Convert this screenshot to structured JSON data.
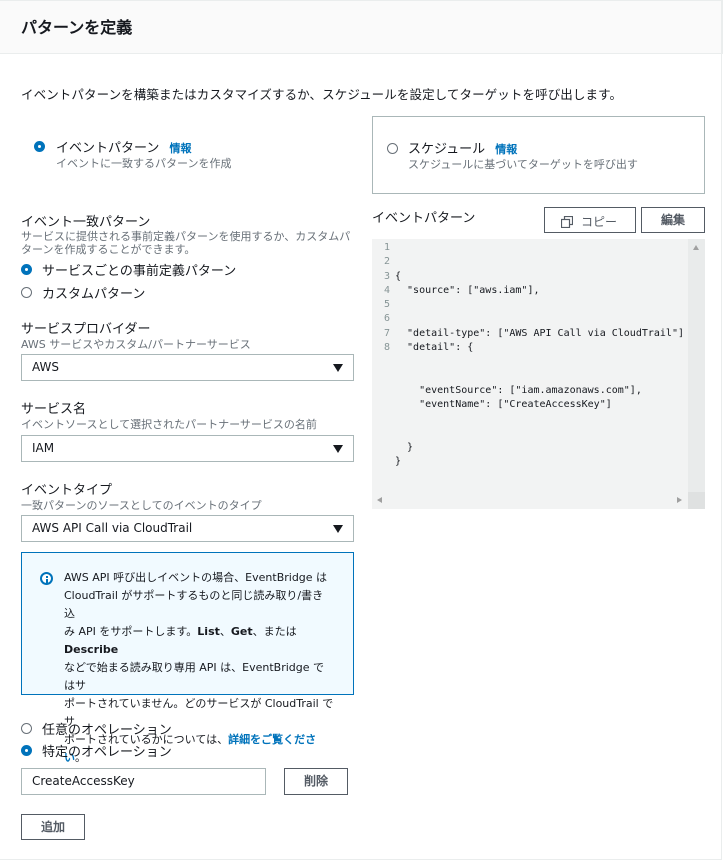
{
  "panel": {
    "title": "パターンを定義"
  },
  "description": "イベントパターンを構築またはカスタマイズするか、スケジュールを設定してターゲットを呼び出します。",
  "pattern_type": {
    "event_pattern": {
      "label": "イベントパターン",
      "info": "情報",
      "sub": "イベントに一致するパターンを作成",
      "selected": true
    },
    "schedule": {
      "label": "スケジュール",
      "info": "情報",
      "sub": "スケジュールに基づいてターゲットを呼び出す",
      "selected": false
    }
  },
  "match": {
    "title": "イベント一致パターン",
    "desc_line1": "サービスに提供される事前定義パターンを使用するか、カスタムパ",
    "desc_line2": "ターンを作成することができます。",
    "options": [
      {
        "label": "サービスごとの事前定義パターン",
        "selected": true
      },
      {
        "label": "カスタムパターン",
        "selected": false
      }
    ]
  },
  "provider": {
    "label": "サービスプロバイダー",
    "sub": "AWS サービスやカスタム/パートナーサービス",
    "value": "AWS"
  },
  "service": {
    "label": "サービス名",
    "sub": "イベントソースとして選択されたパートナーサービスの名前",
    "value": "IAM"
  },
  "event_type": {
    "label": "イベントタイプ",
    "sub": "一致パターンのソースとしてのイベントのタイプ",
    "value": "AWS API Call via CloudTrail"
  },
  "info": {
    "p1": "AWS API 呼び出しイベントの場合、EventBridge は",
    "p2": "CloudTrail がサポートするものと同じ読み取り/書き込",
    "p3": "み API をサポートします。",
    "b1": "List",
    "sep1": "、",
    "b2": "Get",
    "sep2": "、または ",
    "b3": "Describe",
    "p4": "などで始まる読み取り専用 API は、EventBridge ではサ",
    "p5": "ポートされていません。どのサービスが CloudTrail でサ",
    "p6": "ポートされているかについては、",
    "link": "詳細をご覧ください",
    "end": "。"
  },
  "operations": {
    "options": [
      {
        "label": "任意のオペレーション",
        "selected": false
      },
      {
        "label": "特定のオペレーション",
        "selected": true
      }
    ],
    "value": "CreateAccessKey",
    "delete_label": "削除",
    "add_label": "追加"
  },
  "editor": {
    "title": "イベントパターン",
    "copy_label": "コピー",
    "edit_label": "編集",
    "line_numbers": [
      "1",
      "2",
      "3",
      "4",
      "5",
      "6",
      "7",
      "8"
    ],
    "lines": [
      "{",
      "  \"source\": [\"aws.iam\"],",
      "  \"detail-type\": [\"AWS API Call via CloudTrail\"],",
      "  \"detail\": {",
      "    \"eventSource\": [\"iam.amazonaws.com\"],",
      "    \"eventName\": [\"CreateAccessKey\"]",
      "  }",
      "}"
    ]
  },
  "colors": {
    "accent": "#0073bb",
    "text": "#16191f",
    "muted": "#687078",
    "border": "#aab7b8"
  }
}
